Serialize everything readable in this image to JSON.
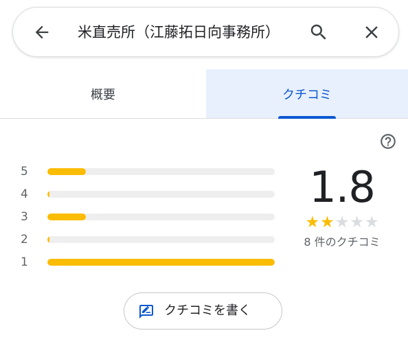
{
  "search": {
    "query": "米直売所（江藤拓日向事務所）"
  },
  "tabs": [
    {
      "label": "概要",
      "selected": false
    },
    {
      "label": "クチコミ",
      "selected": true
    }
  ],
  "histogram": [
    {
      "star": "5",
      "fraction": 0.17
    },
    {
      "star": "4",
      "fraction": 0.0
    },
    {
      "star": "3",
      "fraction": 0.17
    },
    {
      "star": "2",
      "fraction": 0.0
    },
    {
      "star": "1",
      "fraction": 1.0
    }
  ],
  "summary": {
    "rating": "1.8",
    "stars_filled": 2,
    "stars_total": 5,
    "review_count": "8 件のクチコミ"
  },
  "write_review": {
    "label": "クチコミを書く"
  },
  "colors": {
    "accent": "#0b57d0",
    "tab_selected_bg": "#e8f0fe",
    "star": "#fbbc04",
    "track": "#eeeeee"
  },
  "icons": {
    "back": "arrow-back-icon",
    "search": "search-icon",
    "close": "close-icon",
    "help": "help-circle-icon",
    "write": "rate-review-icon"
  }
}
